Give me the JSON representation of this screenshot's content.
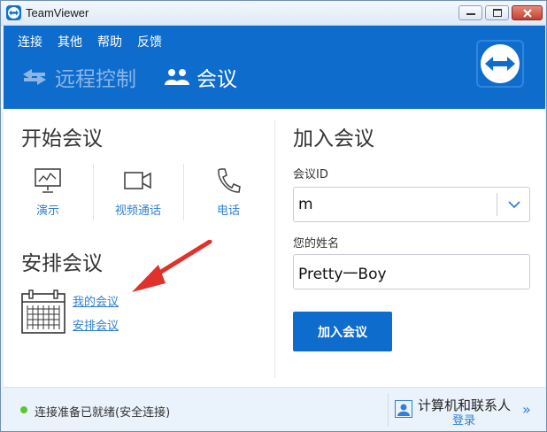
{
  "window": {
    "title": "TeamViewer"
  },
  "menu": [
    "连接",
    "其他",
    "帮助",
    "反馈"
  ],
  "nav": {
    "remote_label": "远程控制",
    "meeting_label": "会议"
  },
  "start_meeting": {
    "title": "开始会议",
    "actions": [
      "演示",
      "视频通话",
      "电话"
    ]
  },
  "schedule": {
    "title": "安排会议",
    "links": [
      "我的会议",
      "安排会议"
    ]
  },
  "join": {
    "title": "加入会议",
    "meeting_id_label": "会议ID",
    "meeting_id_value": "m",
    "name_label": "您的姓名",
    "name_value": "Pretty一Boy",
    "button_label": "加入会议"
  },
  "status": {
    "text": "连接准备已就绪(安全连接)",
    "contacts_title": "计算机和联系人",
    "contacts_login": "登录"
  },
  "colors": {
    "brand_blue": "#0e6ccd",
    "link_blue": "#2f7fd6",
    "status_green": "#5ec52a",
    "annotation_red": "#e0322b"
  },
  "icons": [
    "teamviewer-logo-icon",
    "arrows-icon",
    "people-icon",
    "monitor-icon",
    "video-camera-icon",
    "phone-icon",
    "calendar-icon",
    "chevron-down-icon",
    "contact-card-icon",
    "double-chevron-right-icon",
    "red-arrow-annotation"
  ]
}
